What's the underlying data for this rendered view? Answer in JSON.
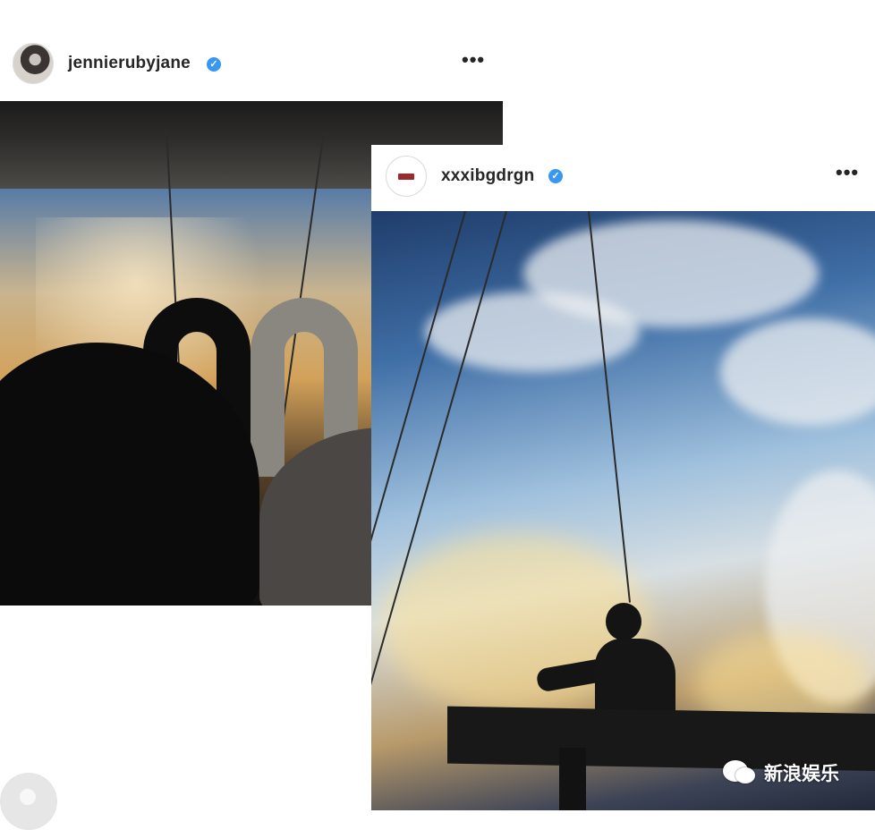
{
  "posts": [
    {
      "username": "jennierubyjane",
      "verified_icon": "verified-badge-icon",
      "more_label": "•••",
      "image_subject": "swan-silhouettes-photo"
    },
    {
      "username": "xxxibgdrgn",
      "verified_icon": "verified-badge-icon",
      "more_label": "•••",
      "image_subject": "person-on-swing-sky-photo"
    }
  ],
  "watermark": {
    "icon": "wechat-icon",
    "text": "新浪娱乐"
  },
  "colors": {
    "verified_blue": "#3897f0",
    "text_primary": "#262626",
    "background": "#ffffff"
  }
}
